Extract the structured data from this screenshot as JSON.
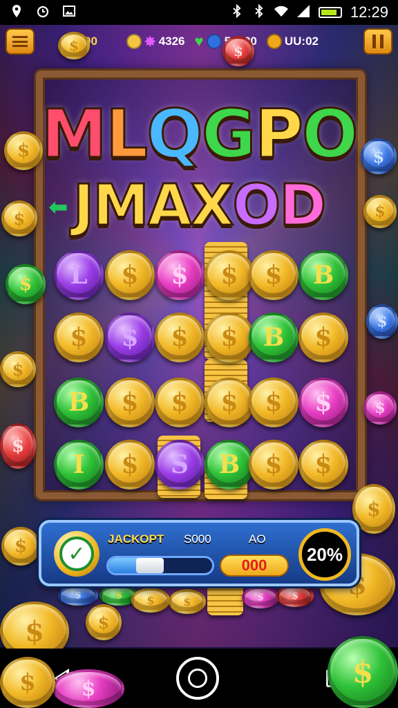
{
  "status_bar": {
    "time": "12:29",
    "left_icons": [
      "location-icon",
      "alarm-icon",
      "image-icon"
    ],
    "right_icons": [
      "bluetooth-icon",
      "bluetooth-icon",
      "wifi-icon",
      "signal-icon",
      "battery-icon"
    ]
  },
  "hud": {
    "menu_icon": "menu-icon",
    "green_gems": "00",
    "stars": "4326",
    "hearts_score": "50520",
    "timer": "UU:02",
    "pause_icon": "pause-icon"
  },
  "title": {
    "line1": [
      "M",
      "L",
      "Q",
      "G",
      "P",
      "O"
    ],
    "line2": [
      "J",
      "M",
      "A",
      "X",
      "O",
      "D"
    ]
  },
  "board": {
    "coins": [
      {
        "color": "purple",
        "symbol": "L"
      },
      {
        "color": "gold",
        "symbol": "$"
      },
      {
        "color": "magenta",
        "symbol": "$"
      },
      {
        "color": "gold",
        "symbol": "$"
      },
      {
        "color": "gold",
        "symbol": "$"
      },
      {
        "color": "green",
        "symbol": "B"
      },
      {
        "color": "gold",
        "symbol": "$"
      },
      {
        "color": "purple",
        "symbol": "$"
      },
      {
        "color": "gold",
        "symbol": "$"
      },
      {
        "color": "gold",
        "symbol": "$"
      },
      {
        "color": "green",
        "symbol": "B"
      },
      {
        "color": "gold",
        "symbol": "$"
      },
      {
        "color": "green",
        "symbol": "B"
      },
      {
        "color": "gold",
        "symbol": "$"
      },
      {
        "color": "gold",
        "symbol": "$"
      },
      {
        "color": "gold",
        "symbol": "$"
      },
      {
        "color": "gold",
        "symbol": "$"
      },
      {
        "color": "magenta",
        "symbol": "$"
      },
      {
        "color": "green",
        "symbol": "I"
      },
      {
        "color": "gold",
        "symbol": "$"
      },
      {
        "color": "purple",
        "symbol": "S"
      },
      {
        "color": "green",
        "symbol": "B"
      },
      {
        "color": "gold",
        "symbol": "$"
      },
      {
        "color": "gold",
        "symbol": "$"
      }
    ]
  },
  "panel": {
    "check_icon": "check-icon",
    "jackpot_label": "JACKOPT",
    "jackpot_value": "S000",
    "ao_label": "AO",
    "amount": "000",
    "percent": "20%",
    "progress": 0.4
  },
  "nav": {
    "icons": [
      "back-icon",
      "home-icon",
      "recents-icon"
    ]
  },
  "colors": {
    "title_line1": [
      "#ff4d6d",
      "#ff9a3c",
      "#4ab8ff",
      "#3ed64a",
      "#ffd84a",
      "#3ed64a"
    ],
    "title_line2": [
      "#ffd84a",
      "#ffd84a",
      "#ffd84a",
      "#ffd84a",
      "#c86bff",
      "#ff6bd8"
    ]
  }
}
